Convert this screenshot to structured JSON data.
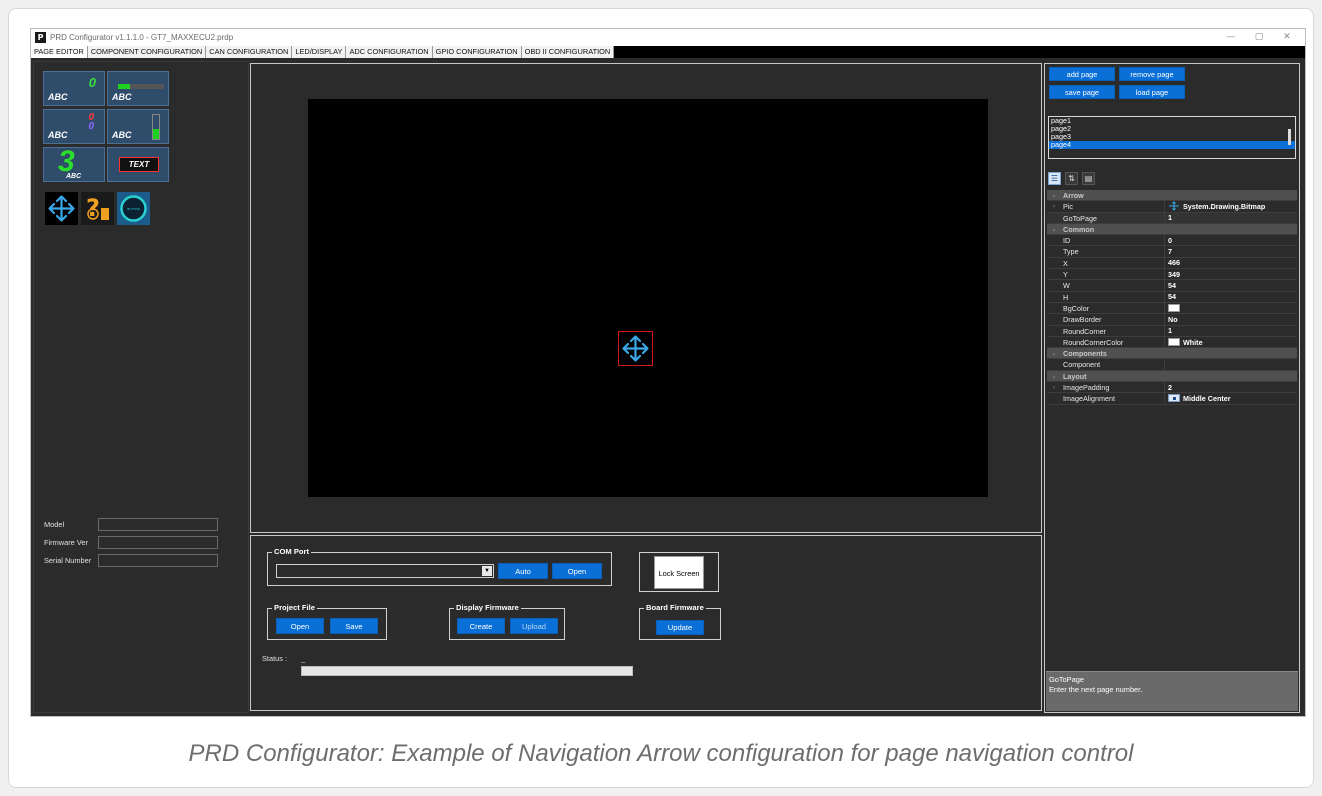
{
  "window": {
    "title": "PRD Configurator v1.1.1.0 - GT7_MAXXECU2.prdp",
    "app_icon_letter": "P",
    "controls": {
      "minimize": "—",
      "maximize": "▢",
      "close": "✕"
    }
  },
  "tabs": [
    "PAGE EDITOR",
    "COMPONENT CONFIGURATION",
    "CAN CONFIGURATION",
    "LED/DISPLAY",
    "ADC CONFIGURATION",
    "GPIO CONFIGURATION",
    "OBD II CONFIGURATION"
  ],
  "palette": {
    "abc": "ABC",
    "zero": "0",
    "three": "3",
    "text": "TEXT",
    "icons": [
      "move-arrows-icon",
      "question-fuel-icon",
      "round-button-icon"
    ],
    "button_word": "BUTTON"
  },
  "device_info": {
    "model_label": "Model",
    "firmware_label": "Firmware Ver",
    "serial_label": "Serial Number"
  },
  "com_port": {
    "title": "COM Port",
    "auto_label": "Auto",
    "open_label": "Open",
    "value": ""
  },
  "lock_screen_label": "Lock Screen",
  "project_file": {
    "title": "Project File",
    "open_label": "Open",
    "save_label": "Save"
  },
  "display_firmware": {
    "title": "Display Firmware",
    "create_label": "Create",
    "upload_label": "Upload"
  },
  "board_firmware": {
    "title": "Board Firmware",
    "update_label": "Update"
  },
  "status": {
    "label": "Status :",
    "value": "_"
  },
  "page_controls": {
    "add_label": "add page",
    "remove_label": "remove page",
    "save_label": "save page",
    "load_label": "load page"
  },
  "pages": [
    "page1",
    "page2",
    "page3",
    "page4"
  ],
  "selected_page": "page4",
  "properties": {
    "arrow_category": "Arrow",
    "pic_name": "Pic",
    "pic_value": "System.Drawing.Bitmap",
    "gotopage_name": "GoToPage",
    "gotopage_value": "1",
    "common_category": "Common",
    "id_name": "ID",
    "id_value": "0",
    "type_name": "Type",
    "type_value": "7",
    "x_name": "X",
    "x_value": "466",
    "y_name": "Y",
    "y_value": "349",
    "w_name": "W",
    "w_value": "54",
    "h_name": "H",
    "h_value": "54",
    "bgcolor_name": "BgColor",
    "drawborder_name": "DrawBorder",
    "drawborder_value": "No",
    "roundcorner_name": "RoundCorner",
    "roundcorner_value": "1",
    "roundcornercolor_name": "RoundCornerColor",
    "roundcornercolor_value": "White",
    "components_category": "Components",
    "component_name": "Component",
    "layout_category": "Layout",
    "imagepadding_name": "ImagePadding",
    "imagepadding_value": "2",
    "imagealignment_name": "ImageAlignment",
    "imagealignment_value": "Middle Center"
  },
  "help": {
    "title": "GoToPage",
    "description": "Enter the next page number."
  },
  "colors": {
    "accent": "#0a6fd6",
    "canvas": "#000000",
    "panel": "#2b2b2b",
    "arrow_icon": "#3aa8e8",
    "selection_border": "#d01818"
  },
  "caption": "PRD Configurator: Example of Navigation Arrow configuration for page navigation control"
}
